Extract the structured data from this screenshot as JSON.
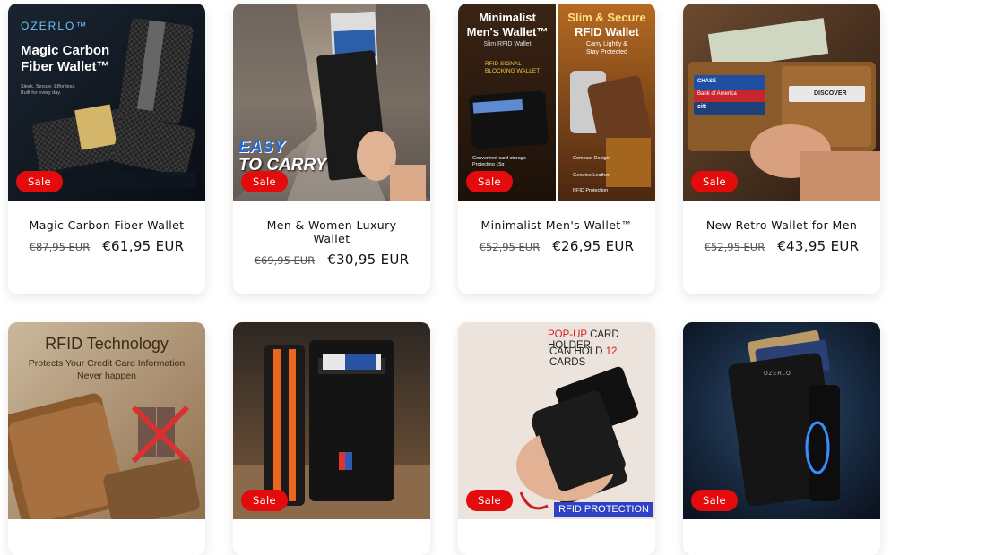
{
  "badge_label": "Sale",
  "products": [
    {
      "title": "Magic Carbon Fiber Wallet",
      "compare_price": "€87,95 EUR",
      "price": "€61,95 EUR",
      "image_text": {
        "brand": "OZERLO™",
        "line1": "Magic Carbon",
        "line2": "Fiber Wallet™",
        "tag1": "Sleek. Secure. Effortless.",
        "tag2": "Built for every day."
      }
    },
    {
      "title": "Men & Women Luxury Wallet",
      "compare_price": "€69,95 EUR",
      "price": "€30,95 EUR",
      "image_text": {
        "line1": "EASY",
        "line2": "TO CARRY"
      }
    },
    {
      "title": "Minimalist Men's Wallet™",
      "compare_price": "€52,95 EUR",
      "price": "€26,95 EUR",
      "image_text": {
        "left1": "Minimalist",
        "left2": "Men's Wallet™",
        "left3": "Slim RFID Wallet",
        "left4": "RFID SIGNAL",
        "left5": "BLOCKING WALLET",
        "right1": "Slim & Secure",
        "right2": "RFID Wallet",
        "right3": "Carry Lightly &",
        "right4": "Stay Protected",
        "feat1": "Convenient card storage",
        "feat2": "Protecting 15g",
        "feat3": "Compact Design",
        "feat4": "Genuine Leather",
        "feat5": "RFID Protection"
      }
    },
    {
      "title": "New Retro Wallet for Men",
      "compare_price": "€52,95 EUR",
      "price": "€43,95 EUR",
      "image_text": {
        "card1": "CHASE",
        "card2": "Bank of America",
        "card3": "citi",
        "card4": "DISCOVER"
      }
    },
    {
      "title": "",
      "compare_price": "",
      "price": "",
      "image_text": {
        "line1": "RFID Technology",
        "line2": "Protects Your Credit Card Information",
        "line3": "Never happen"
      }
    },
    {
      "title": "",
      "compare_price": "",
      "price": "",
      "image_text": {}
    },
    {
      "title": "",
      "compare_price": "",
      "price": "",
      "image_text": {
        "line1a": "POP-UP",
        "line1b": " CARD HOLDER",
        "line2a": "CAN HOLD ",
        "line2b": "12",
        "line2c": " CARDS",
        "footer": "RFID PROTECTION"
      }
    },
    {
      "title": "",
      "compare_price": "",
      "price": "",
      "image_text": {
        "brand": "OZERLO"
      }
    }
  ]
}
